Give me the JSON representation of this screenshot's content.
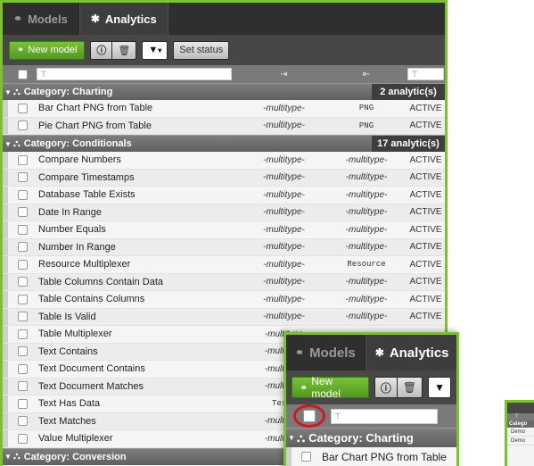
{
  "tabs": [
    {
      "label": "Models",
      "icon": "models-icon",
      "active": false
    },
    {
      "label": "Analytics",
      "icon": "gear-icon",
      "active": true
    }
  ],
  "toolbar": {
    "new_model": "New model",
    "funnel_caret": "▾",
    "set_status": "Set status"
  },
  "filter": {
    "name_placeholder": "⊤",
    "status_placeholder": "⊤"
  },
  "categories": [
    {
      "label": "Category: Charting",
      "count": "2 analytic(s)",
      "rows": [
        {
          "name": "Bar Chart PNG from Table",
          "in": "-multitype-",
          "out": "PNG",
          "out_mono": true,
          "status": "ACTIVE"
        },
        {
          "name": "Pie Chart PNG from Table",
          "in": "-multitype-",
          "out": "PNG",
          "out_mono": true,
          "status": "ACTIVE"
        }
      ]
    },
    {
      "label": "Category: Conditionals",
      "count": "17 analytic(s)",
      "rows": [
        {
          "name": "Compare Numbers",
          "in": "-multitype-",
          "out": "-multitype-",
          "status": "ACTIVE"
        },
        {
          "name": "Compare Timestamps",
          "in": "-multitype-",
          "out": "-multitype-",
          "status": "ACTIVE"
        },
        {
          "name": "Database Table Exists",
          "in": "-multitype-",
          "out": "-multitype-",
          "status": "ACTIVE"
        },
        {
          "name": "Date In Range",
          "in": "-multitype-",
          "out": "-multitype-",
          "status": "ACTIVE"
        },
        {
          "name": "Number Equals",
          "in": "-multitype-",
          "out": "-multitype-",
          "status": "ACTIVE"
        },
        {
          "name": "Number In Range",
          "in": "-multitype-",
          "out": "-multitype-",
          "status": "ACTIVE"
        },
        {
          "name": "Resource Multiplexer",
          "in": "-multitype-",
          "out": "Resource",
          "out_mono": true,
          "status": "ACTIVE"
        },
        {
          "name": "Table Columns Contain Data",
          "in": "-multitype-",
          "out": "-multitype-",
          "status": "ACTIVE"
        },
        {
          "name": "Table Contains Columns",
          "in": "-multitype-",
          "out": "-multitype-",
          "status": "ACTIVE"
        },
        {
          "name": "Table Is Valid",
          "in": "-multitype-",
          "out": "-multitype-",
          "status": "ACTIVE"
        },
        {
          "name": "Table Multiplexer",
          "in": "-multitype",
          "out": "",
          "status": ""
        },
        {
          "name": "Text Contains",
          "in": "-multitype",
          "out": "",
          "status": ""
        },
        {
          "name": "Text Document Contains",
          "in": "-multitype",
          "out": "",
          "status": ""
        },
        {
          "name": "Text Document Matches",
          "in": "-multitype",
          "out": "",
          "status": ""
        },
        {
          "name": "Text Has Data",
          "in": "Text*",
          "in_mono": true,
          "out": "",
          "status": ""
        },
        {
          "name": "Text Matches",
          "in": "-multitype",
          "out": "",
          "status": ""
        },
        {
          "name": "Value Multiplexer",
          "in": "-multitype",
          "out": "",
          "status": ""
        }
      ]
    },
    {
      "label": "Category: Conversion",
      "count": "",
      "rows": []
    }
  ],
  "zoom": {
    "tabs": [
      {
        "label": "Models"
      },
      {
        "label": "Analytics"
      }
    ],
    "new_model": "New model",
    "filter_placeholder": "⊤",
    "category": "Category: Charting",
    "row": "Bar Chart PNG from Table"
  },
  "thumb": {
    "filter": "⊤",
    "category": "Catego",
    "rows": [
      "Demo",
      "Demo"
    ]
  }
}
